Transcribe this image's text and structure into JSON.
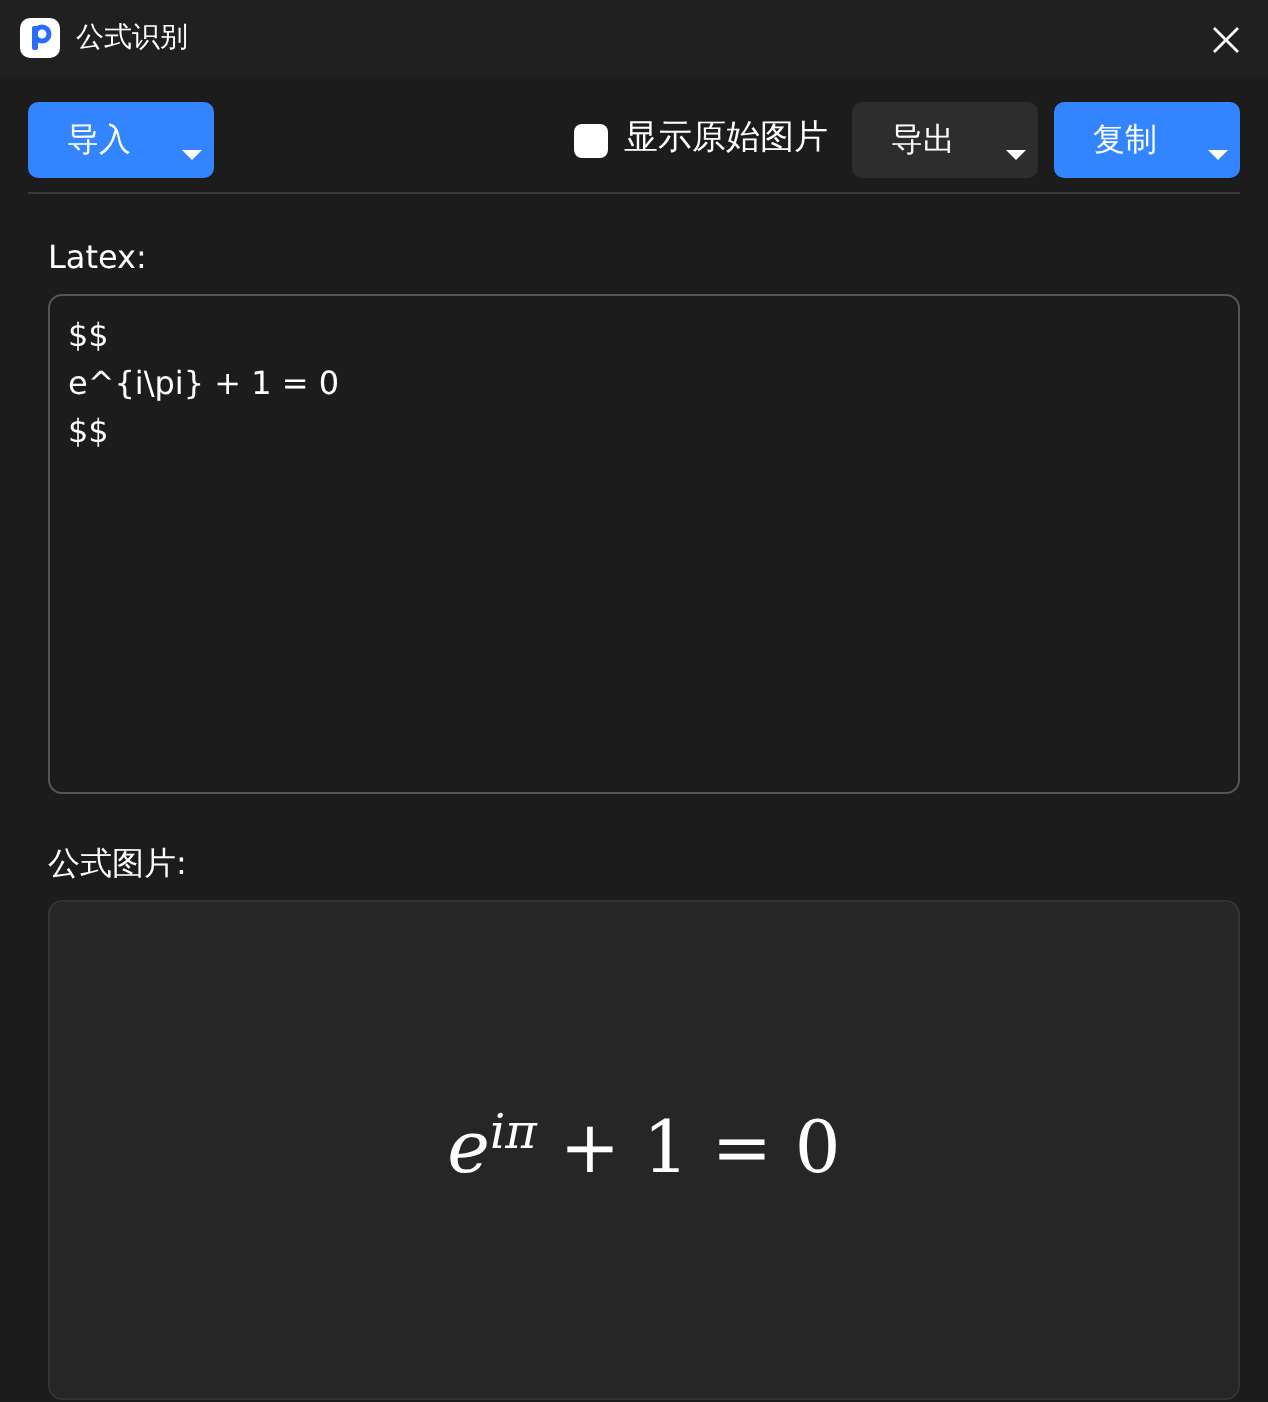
{
  "window": {
    "title": "公式识别"
  },
  "toolbar": {
    "import_button": {
      "label": "导入"
    },
    "show_original": {
      "label": "显示原始图片",
      "checked": false
    },
    "export_button": {
      "label": "导出"
    },
    "copy_button": {
      "label": "复制"
    }
  },
  "latex": {
    "label": "Latex:",
    "value": "$$\ne^{i\\pi} + 1 = 0\n$$"
  },
  "formula_image": {
    "label": "公式图片:",
    "formula": "*e*$^{iπ}$ + 1 = 0"
  }
}
